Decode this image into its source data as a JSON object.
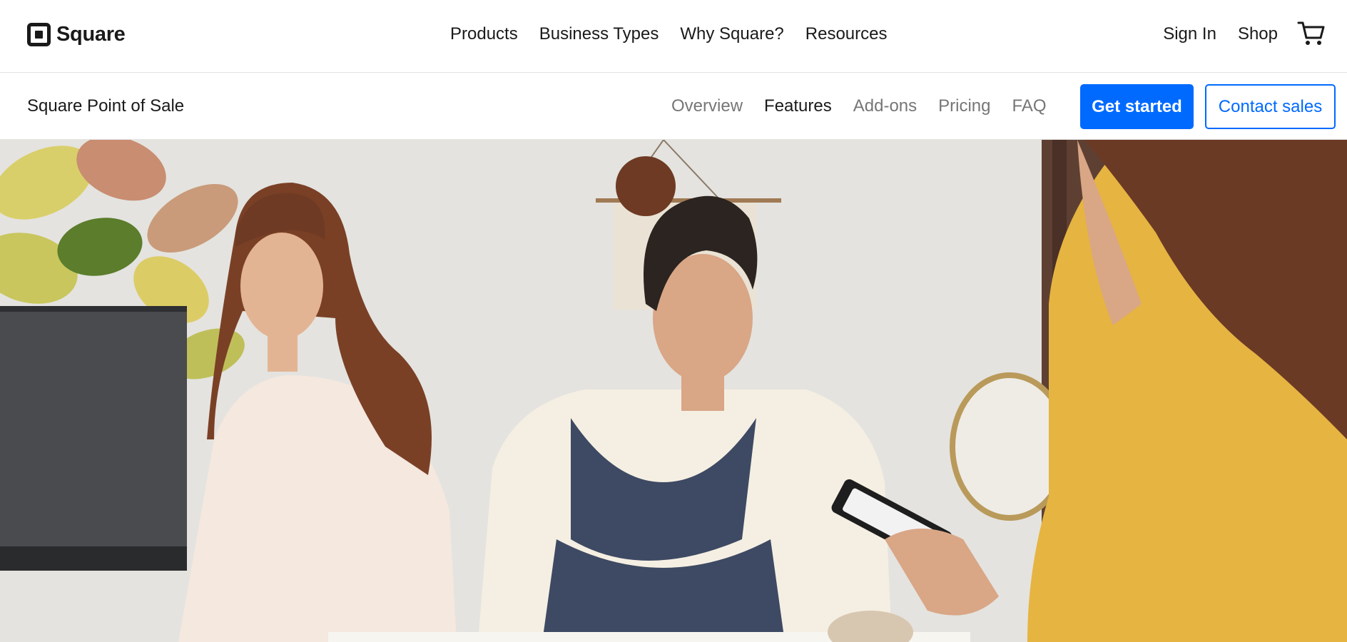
{
  "brand": {
    "name": "Square",
    "logo_icon": "square-logo-icon"
  },
  "topnav": {
    "primary": [
      "Products",
      "Business Types",
      "Why Square?",
      "Resources"
    ],
    "sign_in": "Sign In",
    "shop": "Shop",
    "cart_icon": "shopping-cart-icon"
  },
  "subnav": {
    "product_name": "Square Point of Sale",
    "links": [
      "Overview",
      "Features",
      "Add-ons",
      "Pricing",
      "FAQ"
    ],
    "active_link": "Features",
    "cta_primary": "Get started",
    "cta_secondary": "Contact sales"
  },
  "colors": {
    "accent": "#006aff",
    "text": "#1a1a1a",
    "muted": "#767676",
    "border": "#e3e3e3"
  }
}
